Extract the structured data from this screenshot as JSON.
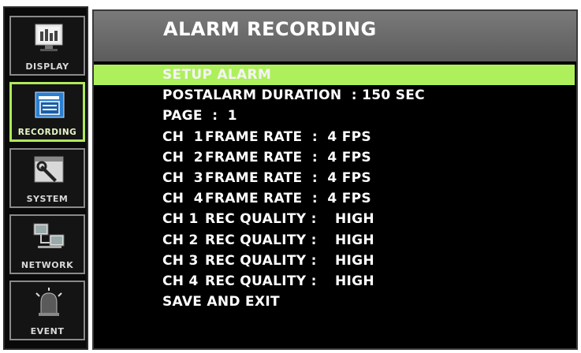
{
  "sidebar": {
    "items": [
      {
        "label": "DISPLAY",
        "icon": "monitor-icon",
        "active": false
      },
      {
        "label": "RECORDING",
        "icon": "camcorder-icon",
        "active": true
      },
      {
        "label": "SYSTEM",
        "icon": "wrench-icon",
        "active": false
      },
      {
        "label": "NETWORK",
        "icon": "network-computers-icon",
        "active": false
      },
      {
        "label": "EVENT",
        "icon": "alarm-siren-icon",
        "active": false
      }
    ]
  },
  "main": {
    "title": "ALARM RECORDING",
    "menu": {
      "setup_alarm": "SETUP ALARM",
      "postalarm": "POSTALARM DURATION  : 150 SEC",
      "page": "PAGE  :  1",
      "frame_rates": [
        {
          "ch": "CH  1",
          "label": "FRAME RATE  :  4 FPS"
        },
        {
          "ch": "CH  2",
          "label": "FRAME RATE  :  4 FPS"
        },
        {
          "ch": "CH  3",
          "label": "FRAME RATE  :  4 FPS"
        },
        {
          "ch": "CH  4",
          "label": "FRAME RATE  :  4 FPS"
        }
      ],
      "rec_quality": [
        {
          "ch": "CH 1",
          "label": "REC QUALITY :",
          "value": "HIGH"
        },
        {
          "ch": "CH 2",
          "label": "REC QUALITY :",
          "value": "HIGH"
        },
        {
          "ch": "CH 3",
          "label": "REC QUALITY :",
          "value": "HIGH"
        },
        {
          "ch": "CH 4",
          "label": "REC QUALITY :",
          "value": "HIGH"
        }
      ],
      "save_exit": "SAVE AND EXIT"
    }
  },
  "colors": {
    "highlight": "#aef05c",
    "active_border": "#aeea5a",
    "header_gray": "#6a6a6a",
    "background": "#000000"
  }
}
